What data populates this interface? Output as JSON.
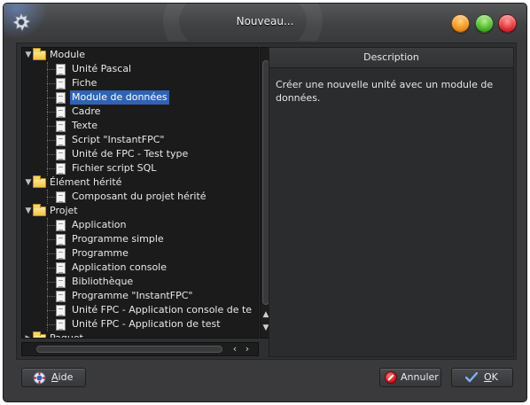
{
  "window": {
    "title": "Nouveau..."
  },
  "tree": {
    "groups": [
      {
        "label": "Module",
        "expanded": true,
        "items": [
          {
            "label": "Unité Pascal"
          },
          {
            "label": "Fiche"
          },
          {
            "label": "Module de données",
            "selected": true
          },
          {
            "label": "Cadre"
          },
          {
            "label": "Texte"
          },
          {
            "label": "Script \"InstantFPC\""
          },
          {
            "label": "Unité de FPC - Test type"
          },
          {
            "label": "Fichier script SQL"
          }
        ]
      },
      {
        "label": "Élément hérité",
        "expanded": true,
        "items": [
          {
            "label": "Composant du projet hérité"
          }
        ]
      },
      {
        "label": "Projet",
        "expanded": true,
        "items": [
          {
            "label": "Application"
          },
          {
            "label": "Programme simple"
          },
          {
            "label": "Programme"
          },
          {
            "label": "Application console"
          },
          {
            "label": "Bibliothèque"
          },
          {
            "label": "Programme \"InstantFPC\""
          },
          {
            "label": "Unité FPC - Application console de te"
          },
          {
            "label": "Unité FPC - Application de test"
          }
        ]
      },
      {
        "label": "Paquet",
        "expanded": false,
        "items": []
      }
    ]
  },
  "description": {
    "header": "Description",
    "text": "Créer une nouvelle unité avec un module de données."
  },
  "buttons": {
    "help": {
      "accel": "A",
      "rest": "ide"
    },
    "cancel": {
      "label": "Annuler"
    },
    "ok": {
      "accel": "O",
      "rest": "K"
    }
  },
  "colors": {
    "selection": "#2f63b3",
    "window_bg": "#3a3a3c",
    "tree_bg": "#1b1b1c"
  }
}
